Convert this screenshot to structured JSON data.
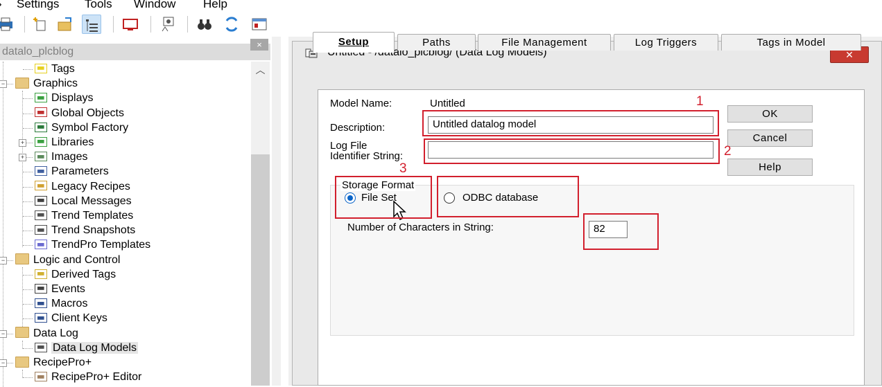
{
  "menu": [
    "Settings",
    "Tools",
    "Window",
    "Help"
  ],
  "toolbar_icons": [
    "print-icon",
    "new-item-icon",
    "open-folder-icon",
    "tree-view-icon",
    "display-monitor-icon",
    "network-icon",
    "binoculars-icon",
    "refresh-icon",
    "window-icon"
  ],
  "explorer": {
    "title": "datalo_plcblog",
    "close": "×",
    "items": [
      {
        "label": "Tags",
        "icon": "tag-icon",
        "level": 2
      },
      {
        "label": "Graphics",
        "icon": "folder-icon",
        "level": 1,
        "expander": "−"
      },
      {
        "label": "Displays",
        "icon": "display-icon",
        "level": 2
      },
      {
        "label": "Global Objects",
        "icon": "global-objects-icon",
        "level": 2
      },
      {
        "label": "Symbol Factory",
        "icon": "symbol-factory-icon",
        "level": 2
      },
      {
        "label": "Libraries",
        "icon": "libraries-icon",
        "level": 2,
        "expander": "+"
      },
      {
        "label": "Images",
        "icon": "image-icon",
        "level": 2,
        "expander": "+"
      },
      {
        "label": "Parameters",
        "icon": "parameters-icon",
        "level": 2
      },
      {
        "label": "Legacy Recipes",
        "icon": "recipe-icon",
        "level": 2
      },
      {
        "label": "Local Messages",
        "icon": "local-messages-icon",
        "level": 2
      },
      {
        "label": "Trend Templates",
        "icon": "trend-icon",
        "level": 2
      },
      {
        "label": "Trend Snapshots",
        "icon": "trend-snapshot-icon",
        "level": 2
      },
      {
        "label": "TrendPro Templates",
        "icon": "trendpro-icon",
        "level": 2
      },
      {
        "label": "Logic and Control",
        "icon": "folder-icon",
        "level": 1,
        "expander": "−"
      },
      {
        "label": "Derived Tags",
        "icon": "derived-tags-icon",
        "level": 2
      },
      {
        "label": "Events",
        "icon": "clock-icon",
        "level": 2
      },
      {
        "label": "Macros",
        "icon": "macro-icon",
        "level": 2
      },
      {
        "label": "Client Keys",
        "icon": "keyboard-icon",
        "level": 2
      },
      {
        "label": "Data Log",
        "icon": "folder-icon",
        "level": 1,
        "expander": "−"
      },
      {
        "label": "Data Log Models",
        "icon": "data-log-models-icon",
        "level": 2,
        "selected": true
      },
      {
        "label": "RecipePro+",
        "icon": "folder-icon",
        "level": 1,
        "expander": "−"
      },
      {
        "label": "RecipePro+ Editor",
        "icon": "recipe-editor-icon",
        "level": 2
      }
    ]
  },
  "dialog": {
    "title": "Untitled - /datalo_plcblog/ (Data Log Models)",
    "close": "✕",
    "tabs": [
      {
        "label": "Setup",
        "active": true
      },
      {
        "label": "Paths"
      },
      {
        "label": "File Management"
      },
      {
        "label": "Log Triggers"
      },
      {
        "label": "Tags in Model"
      }
    ],
    "model_name_label": "Model Name:",
    "model_name_value": "Untitled",
    "description_label": "Description:",
    "description_value": "Untitled datalog model",
    "log_file_label_1": "Log File",
    "log_file_label_2": "Identifier String:",
    "log_file_value": "",
    "storage_format_label": "Storage Format",
    "option_file_set": "File Set",
    "option_odbc": "ODBC database",
    "selected_storage": "File Set",
    "num_chars_label": "Number of Characters in String:",
    "num_chars_value": "82",
    "buttons": {
      "ok": "OK",
      "cancel": "Cancel",
      "help": "Help"
    }
  },
  "annotations": {
    "a1": "1",
    "a2": "2",
    "a3": "3"
  },
  "colors": {
    "annotation_red": "#d21f2d",
    "radio_blue": "#0a64c8",
    "selection_gray": "#e5e5e5"
  }
}
